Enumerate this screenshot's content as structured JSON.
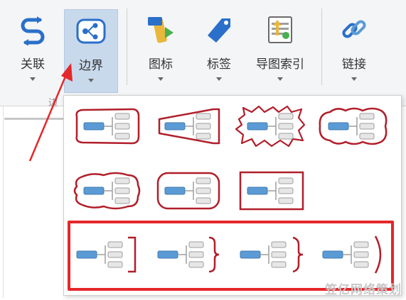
{
  "ribbon": {
    "buttons": [
      {
        "label": "关联",
        "icon": "relationship-icon"
      },
      {
        "label": "边界",
        "icon": "boundary-icon"
      },
      {
        "label": "图标",
        "icon": "icon-marker-icon"
      },
      {
        "label": "标签",
        "icon": "tag-icon"
      },
      {
        "label": "导图索引",
        "icon": "map-index-icon"
      },
      {
        "label": "链接",
        "icon": "link-icon"
      }
    ],
    "active": "边界",
    "group_label": "边"
  },
  "dropdown": {
    "rows": [
      [
        "rounded-rect",
        "tapered-rect",
        "spiky",
        "wavy-rounded"
      ],
      [
        "wavy-octagon",
        "rounded-square",
        "rectangle"
      ],
      [
        "square-bracket",
        "curly-brace",
        "curly-brace-wide",
        "parenthesis"
      ]
    ],
    "selected_row": 2
  },
  "colors": {
    "boundary_stroke": "#b11e2a",
    "node_fill": "#5b9bd5",
    "subnode_fill": "#e6e6e6",
    "highlight": "#e5262a",
    "active_bg": "#c9d9ec"
  },
  "watermark": "笠亿网络策划"
}
